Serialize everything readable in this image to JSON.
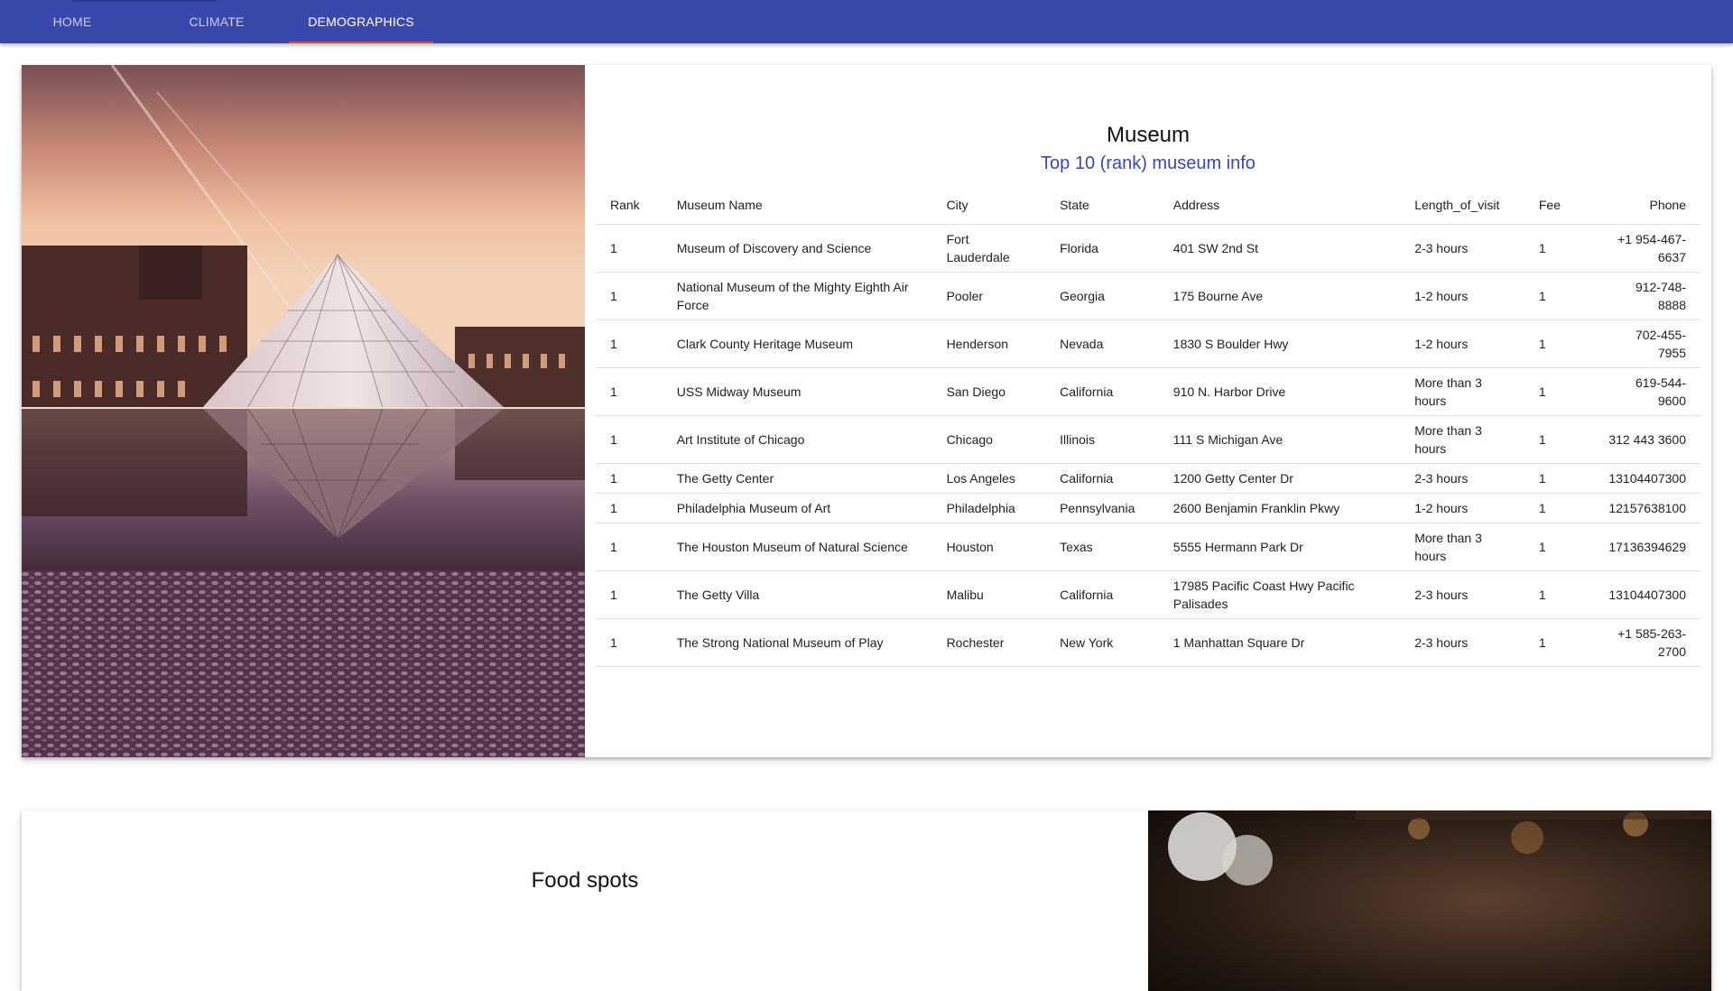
{
  "nav": {
    "tabs": [
      {
        "label": "HOME"
      },
      {
        "label": "CLIMATE"
      },
      {
        "label": "DEMOGRAPHICS"
      }
    ],
    "active_tab": "DEMOGRAPHICS",
    "indicator_color": "#f44336",
    "bar_color": "#3949ab"
  },
  "museum_card": {
    "title": "Museum",
    "subtitle": "Top 10 (rank) museum info",
    "image": "louvre-pyramid-photo",
    "columns": [
      "Rank",
      "Museum Name",
      "City",
      "State",
      "Address",
      "Length_of_visit",
      "Fee",
      "Phone"
    ],
    "rows": [
      {
        "rank": "1",
        "name": "Museum of Discovery and Science",
        "city": "Fort Lauderdale",
        "state": "Florida",
        "address": "401 SW 2nd St",
        "length": "2-3 hours",
        "fee": "1",
        "phone": "+1 954-467-6637"
      },
      {
        "rank": "1",
        "name": "National Museum of the Mighty Eighth Air Force",
        "city": "Pooler",
        "state": "Georgia",
        "address": "175 Bourne Ave",
        "length": "1-2 hours",
        "fee": "1",
        "phone": "912-748-8888"
      },
      {
        "rank": "1",
        "name": "Clark County Heritage Museum",
        "city": "Henderson",
        "state": "Nevada",
        "address": "1830 S Boulder Hwy",
        "length": "1-2 hours",
        "fee": "1",
        "phone": "702-455-7955"
      },
      {
        "rank": "1",
        "name": "USS Midway Museum",
        "city": "San Diego",
        "state": "California",
        "address": "910 N. Harbor Drive",
        "length": "More than 3 hours",
        "fee": "1",
        "phone": "619-544-9600"
      },
      {
        "rank": "1",
        "name": "Art Institute of Chicago",
        "city": "Chicago",
        "state": "Illinois",
        "address": "111 S Michigan Ave",
        "length": "More than 3 hours",
        "fee": "1",
        "phone": "312 443 3600"
      },
      {
        "rank": "1",
        "name": "The Getty Center",
        "city": "Los Angeles",
        "state": "California",
        "address": "1200 Getty Center Dr",
        "length": "2-3 hours",
        "fee": "1",
        "phone": "13104407300"
      },
      {
        "rank": "1",
        "name": "Philadelphia Museum of Art",
        "city": "Philadelphia",
        "state": "Pennsylvania",
        "address": "2600 Benjamin Franklin Pkwy",
        "length": "1-2 hours",
        "fee": "1",
        "phone": "12157638100"
      },
      {
        "rank": "1",
        "name": "The Houston Museum of Natural Science",
        "city": "Houston",
        "state": "Texas",
        "address": "5555 Hermann Park Dr",
        "length": "More than 3 hours",
        "fee": "1",
        "phone": "17136394629"
      },
      {
        "rank": "1",
        "name": "The Getty Villa",
        "city": "Malibu",
        "state": "California",
        "address": "17985 Pacific Coast Hwy Pacific Palisades",
        "length": "2-3 hours",
        "fee": "1",
        "phone": "13104407300"
      },
      {
        "rank": "1",
        "name": "The Strong National Museum of Play",
        "city": "Rochester",
        "state": "New York",
        "address": "1 Manhattan Square Dr",
        "length": "2-3 hours",
        "fee": "1",
        "phone": "+1 585-263-2700"
      }
    ]
  },
  "next_card": {
    "title": "Food spots",
    "image": "restaurant-interior-photo"
  }
}
